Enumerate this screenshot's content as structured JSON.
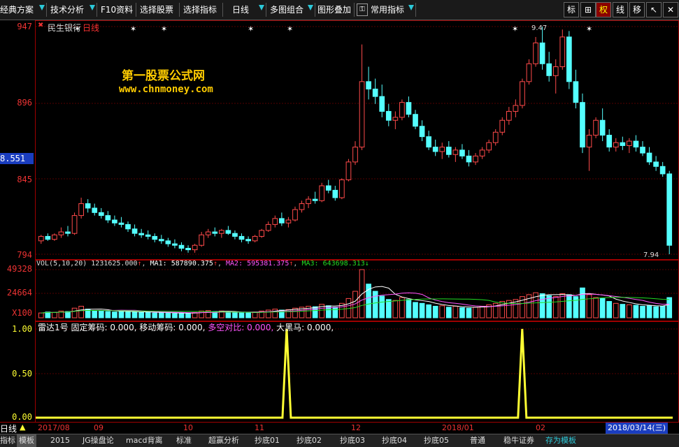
{
  "toolbar": {
    "items": [
      "经典方案",
      "技术分析",
      "F10资料",
      "选择股票",
      "选择指标",
      "日线",
      "多图组合",
      "图形叠加",
      "常用指标"
    ],
    "right_buttons": [
      "标",
      "⊞",
      "权",
      "线",
      "移",
      "↖",
      "✕"
    ]
  },
  "main_chart": {
    "title": "民生银行",
    "period": "日线",
    "y_ticks": [
      "947",
      "896",
      "845",
      "794"
    ],
    "cursor_value": "8.551",
    "high_label": "9.47",
    "low_label": "7.94",
    "watermark_title": "第一股票公式网",
    "watermark_url": "www.chnmoney.com"
  },
  "volume_panel": {
    "indicator": "VOL(5,10,20)",
    "vol_value": "1231625.000",
    "ma1_label": "MA1:",
    "ma1_value": "587890.375",
    "ma2_label": "MA2:",
    "ma2_value": "595381.375",
    "ma3_label": "MA3:",
    "ma3_value": "643698.313",
    "y_ticks": [
      "49328",
      "24664",
      "X100"
    ]
  },
  "radar_panel": {
    "name": "雷达1号",
    "fixed_label": "固定筹码:",
    "fixed_value": "0.000,",
    "moving_label": "移动筹码:",
    "moving_value": "0.000,",
    "bullbear_label": "多空对比:",
    "bullbear_value": "0.000,",
    "bighorse_label": "大黑马:",
    "bighorse_value": "0.000,",
    "y_ticks": [
      "1.00",
      "0.50",
      "0.00"
    ]
  },
  "date_axis": {
    "period": "日线",
    "labels": [
      "2017/08",
      "09",
      "10",
      "11",
      "12",
      "2018/01",
      "02"
    ],
    "current_date": "2018/03/14(三)"
  },
  "bottom_tabs": [
    "指标",
    "模板",
    "2015",
    "JG操盘论",
    "macd背离",
    "标准",
    "超赢分析",
    "抄底01",
    "抄底02",
    "抄底03",
    "抄底04",
    "抄底05",
    "普通",
    "稳牛证券",
    "存为模板"
  ],
  "colors": {
    "up": "#ff4a4a",
    "down": "#54ffff",
    "ma1": "#ffffff",
    "ma2": "#ff55ff",
    "ma3": "#22dd22",
    "signal": "#ffff33",
    "watermark": "#ffcc00"
  },
  "chart_data": {
    "type": "candlestick",
    "price_axis": [
      7.94,
      9.47
    ],
    "candles": [
      [
        8.03,
        8.07,
        8.01,
        8.06
      ],
      [
        8.06,
        8.08,
        8.03,
        8.04
      ],
      [
        8.04,
        8.08,
        8.03,
        8.07
      ],
      [
        8.07,
        8.12,
        8.05,
        8.09
      ],
      [
        8.09,
        8.13,
        8.06,
        8.08
      ],
      [
        8.08,
        8.22,
        8.07,
        8.2
      ],
      [
        8.2,
        8.32,
        8.18,
        8.28
      ],
      [
        8.28,
        8.31,
        8.22,
        8.25
      ],
      [
        8.25,
        8.28,
        8.2,
        8.22
      ],
      [
        8.22,
        8.25,
        8.18,
        8.2
      ],
      [
        8.2,
        8.23,
        8.15,
        8.17
      ],
      [
        8.17,
        8.2,
        8.13,
        8.15
      ],
      [
        8.15,
        8.19,
        8.12,
        8.14
      ],
      [
        8.14,
        8.16,
        8.09,
        8.11
      ],
      [
        8.11,
        8.14,
        8.06,
        8.08
      ],
      [
        8.08,
        8.11,
        8.05,
        8.07
      ],
      [
        8.07,
        8.1,
        8.04,
        8.06
      ],
      [
        8.06,
        8.08,
        8.02,
        8.04
      ],
      [
        8.04,
        8.07,
        8.01,
        8.03
      ],
      [
        8.03,
        8.05,
        7.99,
        8.01
      ],
      [
        8.01,
        8.04,
        7.98,
        8.0
      ],
      [
        8.0,
        8.02,
        7.96,
        7.98
      ],
      [
        7.98,
        8.0,
        7.95,
        7.97
      ],
      [
        7.97,
        8.01,
        7.95,
        8.0
      ],
      [
        8.0,
        8.09,
        7.99,
        8.07
      ],
      [
        8.07,
        8.11,
        8.05,
        8.09
      ],
      [
        8.09,
        8.12,
        8.06,
        8.08
      ],
      [
        8.08,
        8.11,
        8.05,
        8.1
      ],
      [
        8.1,
        8.13,
        8.07,
        8.08
      ],
      [
        8.08,
        8.1,
        8.04,
        8.06
      ],
      [
        8.06,
        8.08,
        8.02,
        8.04
      ],
      [
        8.04,
        8.06,
        8.01,
        8.03
      ],
      [
        8.03,
        8.07,
        8.02,
        8.06
      ],
      [
        8.06,
        8.11,
        8.05,
        8.1
      ],
      [
        8.1,
        8.16,
        8.09,
        8.14
      ],
      [
        8.14,
        8.2,
        8.12,
        8.18
      ],
      [
        8.18,
        8.22,
        8.13,
        8.15
      ],
      [
        8.15,
        8.19,
        8.12,
        8.17
      ],
      [
        8.17,
        8.26,
        8.16,
        8.24
      ],
      [
        8.24,
        8.3,
        8.22,
        8.28
      ],
      [
        8.28,
        8.33,
        8.25,
        8.31
      ],
      [
        8.31,
        8.36,
        8.28,
        8.3
      ],
      [
        8.3,
        8.42,
        8.29,
        8.4
      ],
      [
        8.4,
        8.44,
        8.35,
        8.37
      ],
      [
        8.37,
        8.4,
        8.3,
        8.32
      ],
      [
        8.32,
        8.45,
        8.31,
        8.44
      ],
      [
        8.44,
        8.58,
        8.43,
        8.56
      ],
      [
        8.56,
        8.7,
        8.54,
        8.66
      ],
      [
        8.66,
        9.35,
        8.64,
        9.1
      ],
      [
        9.1,
        9.2,
        8.98,
        9.05
      ],
      [
        9.05,
        9.12,
        8.95,
        9.0
      ],
      [
        9.0,
        9.08,
        8.86,
        8.9
      ],
      [
        8.9,
        8.95,
        8.8,
        8.84
      ],
      [
        8.84,
        8.9,
        8.78,
        8.86
      ],
      [
        8.86,
        8.98,
        8.84,
        8.96
      ],
      [
        8.96,
        9.0,
        8.86,
        8.88
      ],
      [
        8.88,
        8.91,
        8.78,
        8.8
      ],
      [
        8.8,
        8.84,
        8.7,
        8.73
      ],
      [
        8.73,
        8.77,
        8.64,
        8.66
      ],
      [
        8.66,
        8.71,
        8.6,
        8.63
      ],
      [
        8.63,
        8.69,
        8.58,
        8.66
      ],
      [
        8.66,
        8.7,
        8.59,
        8.61
      ],
      [
        8.61,
        8.66,
        8.56,
        8.64
      ],
      [
        8.64,
        8.68,
        8.58,
        8.6
      ],
      [
        8.6,
        8.64,
        8.53,
        8.56
      ],
      [
        8.56,
        8.62,
        8.54,
        8.6
      ],
      [
        8.6,
        8.66,
        8.58,
        8.64
      ],
      [
        8.64,
        8.71,
        8.62,
        8.69
      ],
      [
        8.69,
        8.78,
        8.67,
        8.76
      ],
      [
        8.76,
        8.86,
        8.74,
        8.84
      ],
      [
        8.84,
        8.93,
        8.81,
        8.9
      ],
      [
        8.9,
        8.98,
        8.86,
        8.94
      ],
      [
        8.94,
        9.12,
        8.92,
        9.1
      ],
      [
        9.1,
        9.25,
        9.08,
        9.22
      ],
      [
        9.22,
        9.4,
        9.2,
        9.36
      ],
      [
        9.36,
        9.47,
        9.18,
        9.22
      ],
      [
        9.22,
        9.3,
        9.1,
        9.14
      ],
      [
        9.14,
        9.25,
        9.02,
        9.2
      ],
      [
        9.2,
        9.45,
        9.18,
        9.4
      ],
      [
        9.4,
        9.44,
        9.05,
        9.1
      ],
      [
        9.1,
        9.18,
        8.92,
        8.96
      ],
      [
        8.96,
        9.02,
        8.62,
        8.66
      ],
      [
        8.66,
        8.78,
        8.5,
        8.74
      ],
      [
        8.74,
        8.86,
        8.72,
        8.84
      ],
      [
        8.84,
        8.92,
        8.7,
        8.74
      ],
      [
        8.74,
        8.78,
        8.63,
        8.66
      ],
      [
        8.66,
        8.72,
        8.63,
        8.69
      ],
      [
        8.69,
        8.73,
        8.64,
        8.67
      ],
      [
        8.67,
        8.72,
        8.62,
        8.7
      ],
      [
        8.7,
        8.74,
        8.63,
        8.66
      ],
      [
        8.66,
        8.7,
        8.6,
        8.62
      ],
      [
        8.62,
        8.66,
        8.54,
        8.56
      ],
      [
        8.56,
        8.6,
        8.5,
        8.53
      ],
      [
        8.53,
        8.56,
        8.46,
        8.48
      ],
      [
        8.48,
        8.5,
        7.94,
        8.0
      ]
    ],
    "volume_ratio": [
      0.1,
      0.12,
      0.11,
      0.14,
      0.13,
      0.2,
      0.24,
      0.18,
      0.15,
      0.14,
      0.13,
      0.12,
      0.14,
      0.13,
      0.12,
      0.11,
      0.12,
      0.1,
      0.11,
      0.1,
      0.09,
      0.1,
      0.09,
      0.11,
      0.14,
      0.15,
      0.13,
      0.14,
      0.12,
      0.11,
      0.1,
      0.1,
      0.12,
      0.14,
      0.16,
      0.18,
      0.16,
      0.17,
      0.2,
      0.22,
      0.24,
      0.23,
      0.28,
      0.25,
      0.22,
      0.3,
      0.4,
      0.55,
      1.0,
      0.7,
      0.55,
      0.45,
      0.38,
      0.36,
      0.42,
      0.38,
      0.32,
      0.3,
      0.27,
      0.24,
      0.25,
      0.22,
      0.24,
      0.21,
      0.2,
      0.22,
      0.24,
      0.27,
      0.3,
      0.34,
      0.36,
      0.38,
      0.44,
      0.48,
      0.52,
      0.5,
      0.46,
      0.44,
      0.5,
      0.48,
      0.44,
      0.62,
      0.48,
      0.42,
      0.4,
      0.34,
      0.3,
      0.28,
      0.27,
      0.26,
      0.24,
      0.25,
      0.23,
      0.24,
      0.42
    ],
    "signal_positions": [
      0.392,
      0.763
    ]
  }
}
